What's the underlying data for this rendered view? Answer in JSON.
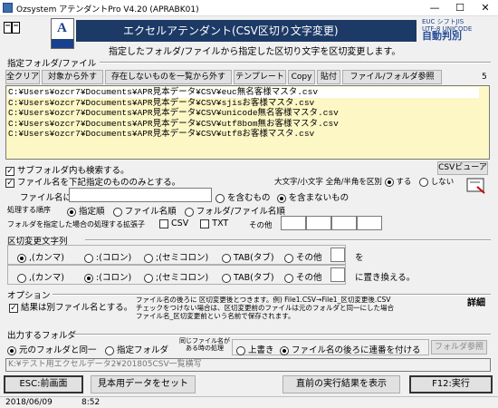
{
  "window": {
    "title": "Ozsystem アテンダントPro V4.20 (APRABK01)",
    "minimize": "—",
    "maximize": "☐",
    "close": "✕"
  },
  "header": {
    "banner": "エクセルアテンダント(CSV区切り文字変更)",
    "description": "指定したフォルダ/ファイルから指定した区切り文字を区切変更します。",
    "brand_line1": "EUC  シフトJIS",
    "brand_line2": "UTF-8  UNICODE",
    "brand_line3": "自動判別"
  },
  "folder_section": {
    "title": "指定フォルダ/ファイル",
    "buttons": [
      "全クリア",
      "対象から外す",
      "存在しないものを一覧から外す",
      "テンプレート",
      "Copy",
      "貼付",
      "ファイル/フォルダ参照"
    ],
    "count": "5",
    "files": [
      "C:¥Users¥ozcr7¥Documents¥APR見本データ¥CSV¥euc無名客様マスタ.csv",
      "C:¥Users¥ozcr7¥Documents¥APR見本データ¥CSV¥sjisお客様マスタ.csv",
      "C:¥Users¥ozcr7¥Documents¥APR見本データ¥CSV¥unicode無名客様マスタ.csv",
      "C:¥Users¥ozcr7¥Documents¥APR見本データ¥CSV¥utf8bom無お客様マスタ.csv",
      "C:¥Users¥ozcr7¥Documents¥APR見本データ¥CSV¥utf8お客様マスタ.csv"
    ]
  },
  "options": {
    "subfolder": "サブフォルダ内も検索する。",
    "only_files": "ファイル名を下記指定のもののみとする。",
    "case_label": "大文字/小文字 全角/半角を区別",
    "case_yes": "する",
    "case_no": "しない",
    "csv_viewer": "CSVビューア",
    "filename_label": "ファイル名に",
    "contains": "を含むもの",
    "not_contains": "を含まないもの",
    "order_label": "処理する順序",
    "order_specified": "指定順",
    "order_filename": "ファイル名順",
    "order_folder": "フォルダ/ファイル名順",
    "ext_label": "フォルダを指定した場合の処理する拡張子",
    "ext_csv": "CSV",
    "ext_txt": "TXT",
    "ext_other": "その他"
  },
  "delim": {
    "title": "区切変更文字列",
    "from": [
      ",(カンマ)",
      ":(コロン)",
      ";(セミコロン)",
      "TAB(タブ)",
      "その他"
    ],
    "to": [
      ",(カンマ)",
      ":(コロン)",
      ";(セミコロン)",
      "TAB(タブ)",
      "その他"
    ],
    "suffix_from": "を",
    "suffix_to": "に置き換える。"
  },
  "option_section": {
    "title": "オプション",
    "separate": "結果は別ファイル名とする。",
    "note1": "ファイル名の後ろに 区切変更後とつきます。例) File1.CSV→File1_区切変更後.CSV",
    "note2": "チェックをつけない場合は、区切変更前のファイルは元のフォルダと同一にした場合",
    "note3": "ファイル名_区切変更前という名前で保存されます。",
    "detail": "詳細"
  },
  "output": {
    "title": "出力するフォルダ",
    "same": "元のフォルダと同一",
    "specified": "指定フォルダ",
    "same_name_label": "同じファイル名がある時の処理",
    "overwrite": "上書き",
    "append": "ファイル名の後ろに連番を付ける",
    "browse": "フォルダ参照",
    "path": "K:¥テスト用エクセルデータ2¥201805CSV一覧横写"
  },
  "footer": {
    "prev": "ESC:前画面",
    "sample": "見本用データをセット",
    "last_result": "直前の実行結果を表示",
    "run": "F12:実行"
  },
  "status": {
    "date": "2018/06/09",
    "time": "8:52"
  }
}
